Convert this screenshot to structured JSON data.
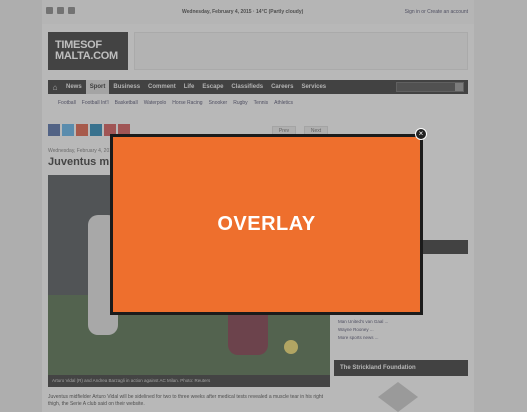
{
  "topbar": {
    "date": "Wednesday, February 4, 2015 · 14°C (Partly cloudy)",
    "signin": "Sign in or Create an account"
  },
  "logo": {
    "line1": "TIMESOF",
    "line2": "MALTA.COM"
  },
  "nav": {
    "items": [
      "News",
      "Sport",
      "Business",
      "Comment",
      "Life",
      "Escape",
      "Classifieds",
      "Careers",
      "Services"
    ],
    "active": "Sport"
  },
  "subnav": [
    "Football",
    "Football Int'l",
    "Basketball",
    "Waterpolo",
    "Horse Racing",
    "Snooker",
    "Rugby",
    "Tennis",
    "Athletics"
  ],
  "pager": {
    "prev": "Prev",
    "next": "Next"
  },
  "article": {
    "breadcrumb": "Wednesday, February 4, 2015",
    "headline": "Juventus m",
    "caption": "Arturo Vidal (R) and Andrea Barzagli in action against AC Milan. Photo: Reuters",
    "body": "Juventus midfielder Arturo Vidal will be sidelined for two to three weeks after medical tests revealed a muscle tear in his right thigh, the Serie A club said on their website."
  },
  "sidebar": {
    "links": [
      "Man United's van Gaal ...",
      "Wayne Rooney ...",
      "More sports news ..."
    ],
    "foundation_title": "The Strickland Foundation"
  },
  "overlay": {
    "label": "OVERLAY",
    "close_glyph": "×"
  },
  "colors": {
    "overlay_orange": "#ee6f2d",
    "nav_dark": "#1e1e1e"
  }
}
